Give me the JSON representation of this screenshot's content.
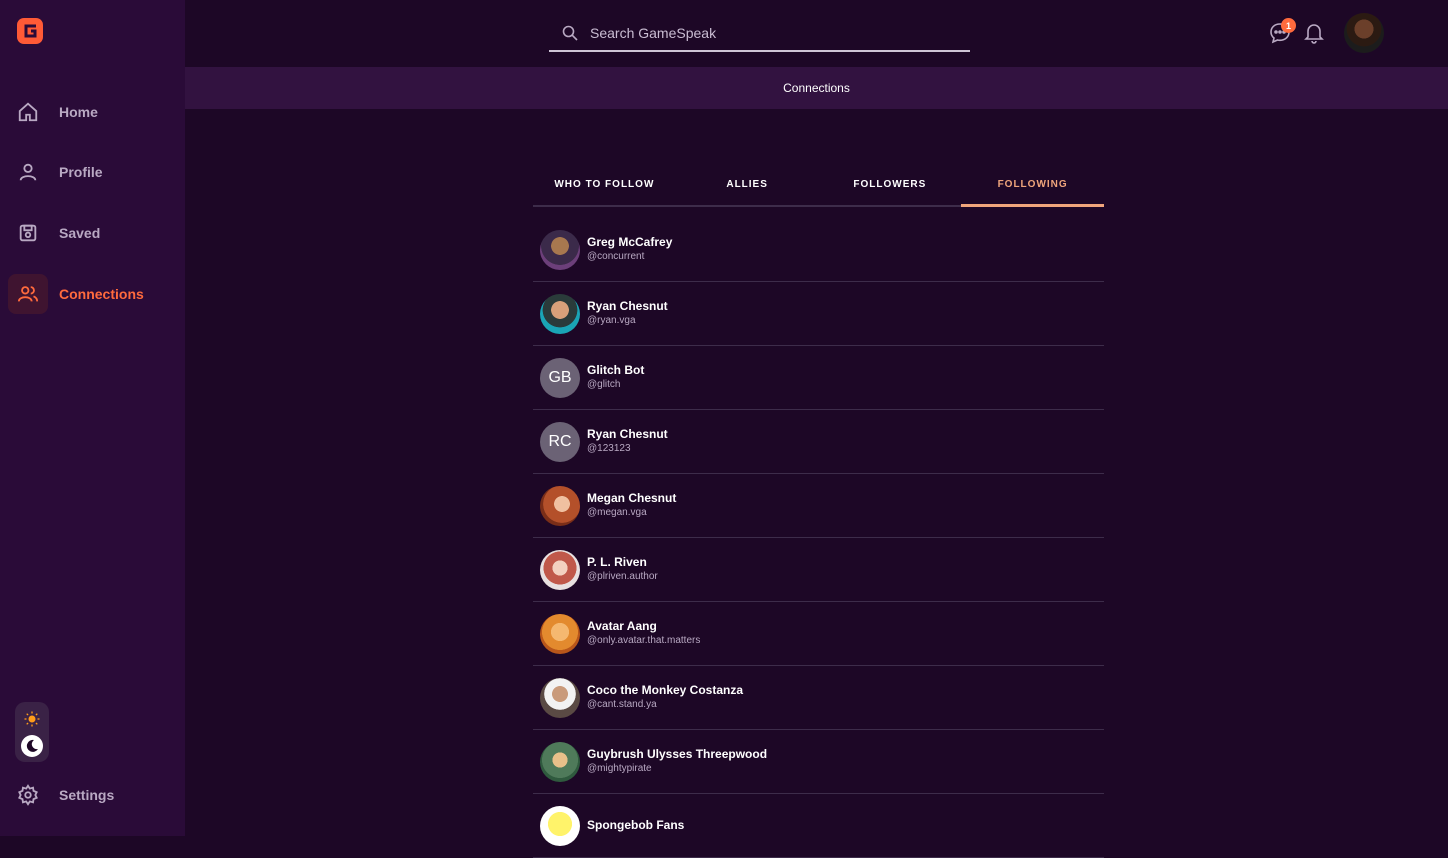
{
  "search": {
    "placeholder": "Search GameSpeak"
  },
  "notifications": {
    "chat_count": "1"
  },
  "sidebar": {
    "items": [
      {
        "label": "Home",
        "icon": "home-icon"
      },
      {
        "label": "Profile",
        "icon": "person-icon"
      },
      {
        "label": "Saved",
        "icon": "save-icon"
      },
      {
        "label": "Connections",
        "icon": "people-icon",
        "active": true
      }
    ],
    "settings_label": "Settings"
  },
  "header": {
    "title": "Connections"
  },
  "tabs": [
    {
      "label": "WHO TO FOLLOW"
    },
    {
      "label": "ALLIES"
    },
    {
      "label": "FOLLOWERS"
    },
    {
      "label": "FOLLOWING",
      "active": true
    }
  ],
  "users": [
    {
      "name": "Greg McCafrey",
      "handle": "@concurrent",
      "initials": ""
    },
    {
      "name": "Ryan Chesnut",
      "handle": "@ryan.vga",
      "initials": ""
    },
    {
      "name": "Glitch Bot",
      "handle": "@glitch",
      "initials": "GB"
    },
    {
      "name": "Ryan Chesnut",
      "handle": "@123123",
      "initials": "RC"
    },
    {
      "name": "Megan Chesnut",
      "handle": "@megan.vga",
      "initials": ""
    },
    {
      "name": "P. L. Riven",
      "handle": "@plriven.author",
      "initials": ""
    },
    {
      "name": "Avatar Aang",
      "handle": "@only.avatar.that.matters",
      "initials": ""
    },
    {
      "name": "Coco the Monkey Costanza",
      "handle": "@cant.stand.ya",
      "initials": ""
    },
    {
      "name": "Guybrush Ulysses Threepwood",
      "handle": "@mightypirate",
      "initials": ""
    },
    {
      "name": "Spongebob Fans",
      "handle": "",
      "initials": ""
    }
  ],
  "colors": {
    "accent": "#ff6a3d",
    "tab_active": "#f0a57c",
    "background": "#1d0726",
    "sidebar": "#2a0b38"
  }
}
